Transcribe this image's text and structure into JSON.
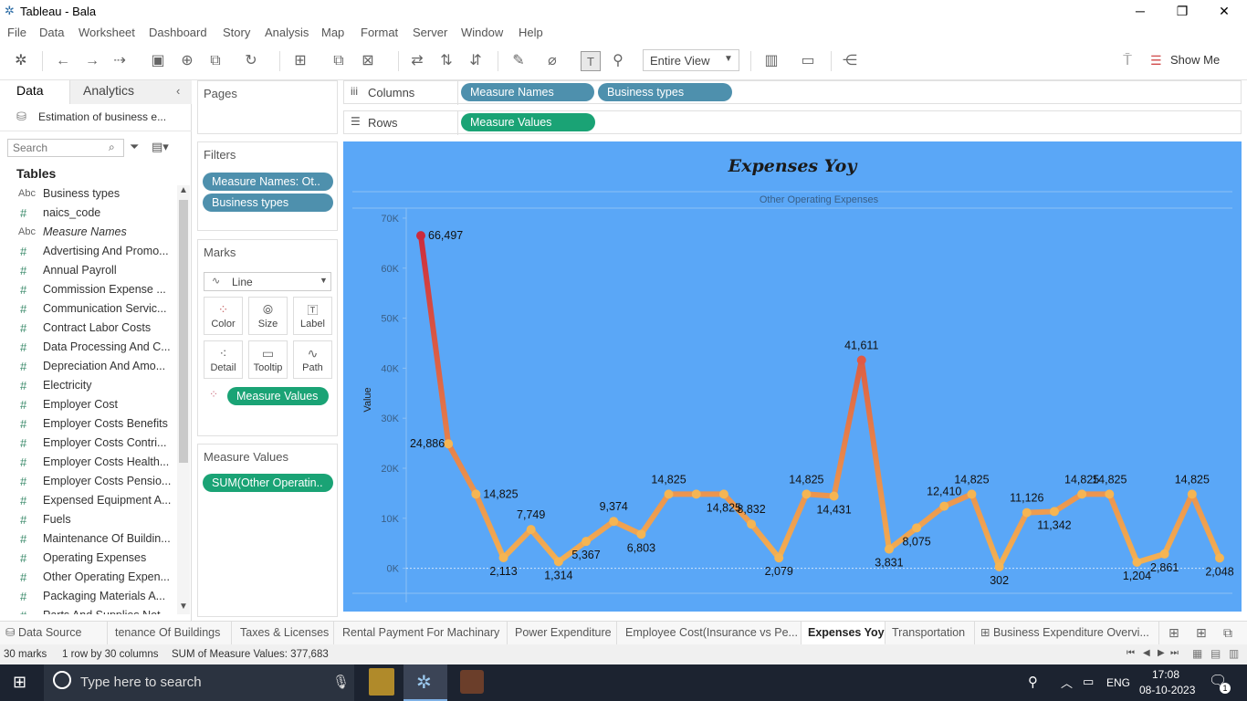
{
  "window": {
    "title": "Tableau - Bala",
    "minimize": "─",
    "maximize": "❐",
    "close": "✕"
  },
  "menu": [
    "File",
    "Data",
    "Worksheet",
    "Dashboard",
    "Story",
    "Analysis",
    "Map",
    "Format",
    "Server",
    "Window",
    "Help"
  ],
  "toolbar": {
    "fit_select": "Entire View",
    "show_me": "Show Me"
  },
  "data_pane": {
    "tab_data": "Data",
    "tab_analytics": "Analytics",
    "datasource": "Estimation of business e...",
    "search_placeholder": "Search",
    "tables_heading": "Tables",
    "fields": [
      {
        "type": "Abc",
        "name": "Business types"
      },
      {
        "type": "#",
        "name": "naics_code"
      },
      {
        "type": "Abc",
        "name": "Measure Names"
      },
      {
        "type": "#",
        "name": "Advertising And Promo..."
      },
      {
        "type": "#",
        "name": "Annual Payroll"
      },
      {
        "type": "#",
        "name": "Commission Expense ..."
      },
      {
        "type": "#",
        "name": "Communication Servic..."
      },
      {
        "type": "#",
        "name": "Contract Labor Costs"
      },
      {
        "type": "#",
        "name": "Data Processing And C..."
      },
      {
        "type": "#",
        "name": "Depreciation And Amo..."
      },
      {
        "type": "#",
        "name": "Electricity"
      },
      {
        "type": "#",
        "name": "Employer Cost"
      },
      {
        "type": "#",
        "name": "Employer Costs Benefits"
      },
      {
        "type": "#",
        "name": "Employer Costs Contri..."
      },
      {
        "type": "#",
        "name": "Employer Costs Health..."
      },
      {
        "type": "#",
        "name": "Employer Costs Pensio..."
      },
      {
        "type": "#",
        "name": "Expensed Equipment A..."
      },
      {
        "type": "#",
        "name": "Fuels"
      },
      {
        "type": "#",
        "name": "Maintenance Of Buildin..."
      },
      {
        "type": "#",
        "name": "Operating Expenses"
      },
      {
        "type": "#",
        "name": "Other Operating Expen..."
      },
      {
        "type": "#",
        "name": "Packaging Materials A..."
      },
      {
        "type": "#",
        "name": "Parts And Supplies Not..."
      }
    ]
  },
  "cards": {
    "pages": "Pages",
    "filters": "Filters",
    "filter_pills": [
      "Measure Names: Ot..",
      "Business types"
    ],
    "marks": "Marks",
    "mark_type": "Line",
    "mark_buttons": [
      {
        "label": "Color",
        "icon": "color-icon"
      },
      {
        "label": "Size",
        "icon": "size-icon"
      },
      {
        "label": "Label",
        "icon": "label-icon"
      },
      {
        "label": "Detail",
        "icon": "detail-icon"
      },
      {
        "label": "Tooltip",
        "icon": "tooltip-icon"
      },
      {
        "label": "Path",
        "icon": "path-icon"
      }
    ],
    "marks_pill": "Measure Values",
    "measure_values": "Measure Values",
    "measure_values_pill": "SUM(Other Operatin.."
  },
  "shelves": {
    "columns_label": "Columns",
    "rows_label": "Rows",
    "columns_pills": [
      "Measure Names",
      "Business types"
    ],
    "rows_pills": [
      "Measure Values"
    ]
  },
  "chart_data": {
    "type": "line",
    "title": "Expenses Yoy",
    "subtitle": "Other Operating Expenses",
    "ylabel": "Value",
    "ylim": [
      -5000,
      72000
    ],
    "yticks": [
      0,
      10000,
      20000,
      30000,
      40000,
      50000,
      60000,
      70000
    ],
    "ytick_labels": [
      "0K",
      "10K",
      "20K",
      "30K",
      "40K",
      "50K",
      "60K",
      "70K"
    ],
    "values": [
      66497,
      24886,
      14825,
      2113,
      7749,
      1314,
      5367,
      9374,
      6803,
      14825,
      14825,
      14825,
      8832,
      2079,
      14825,
      14431,
      41611,
      3831,
      8075,
      12410,
      14825,
      302,
      11126,
      11342,
      14825,
      14825,
      1204,
      2861,
      14825,
      2048
    ],
    "labels": [
      "66,497",
      "24,886",
      "14,825",
      "2,113",
      "7,749",
      "1,314",
      "5,367",
      "9,374",
      "6,803",
      "14,825",
      "",
      "14,825",
      "8,832",
      "2,079",
      "14,825",
      "14,431",
      "41,611",
      "3,831",
      "8,075",
      "12,410",
      "14,825",
      "302",
      "11,126",
      "11,342",
      "14,825",
      "14,825",
      "1,204",
      "2,861",
      "14,825",
      "2,048"
    ],
    "label_pos": [
      "r",
      "l",
      "r",
      "b",
      "t",
      "b",
      "b",
      "t",
      "b",
      "t",
      "",
      "b",
      "t",
      "b",
      "t",
      "b",
      "t",
      "b",
      "b",
      "t",
      "t",
      "b",
      "t",
      "b",
      "t",
      "t",
      "b",
      "b",
      "t",
      "b"
    ],
    "color_low": "#f5b553",
    "color_high": "#cc2a3c",
    "background": "#5aa7f7"
  },
  "sheet_tabs": [
    "Data Source",
    "tenance Of Buildings",
    "Taxes & Licenses",
    "Rental Payment For Machinary",
    "Power Expenditure",
    "Employee Cost(Insurance vs Pe...",
    "Expenses Yoy",
    "Transportation",
    "Business Expenditure Overvi..."
  ],
  "status": {
    "marks": "30 marks",
    "rows_cols": "1 row by 30 columns",
    "sum": "SUM of Measure Values: 377,683"
  },
  "taskbar": {
    "search_placeholder": "Type here to search",
    "lang": "ENG",
    "time": "17:08",
    "date": "08-10-2023",
    "notif_count": "1"
  }
}
